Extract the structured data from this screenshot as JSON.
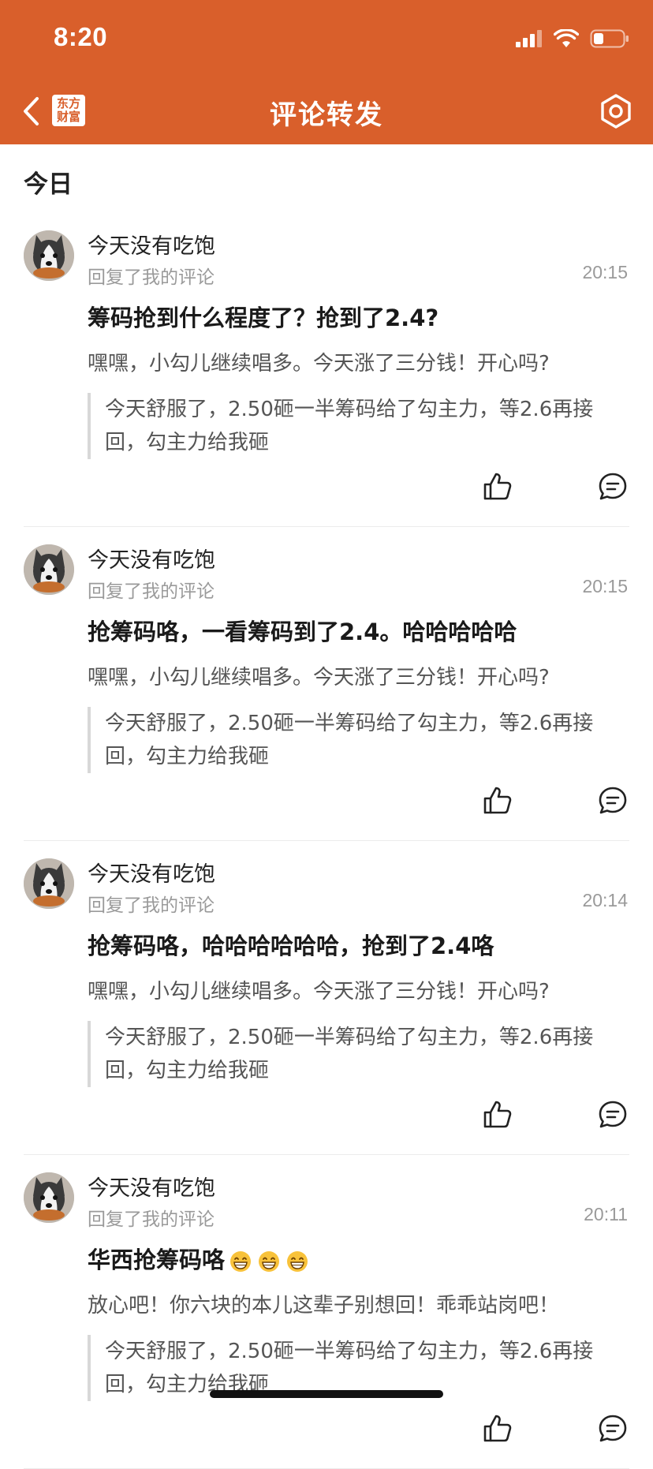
{
  "status_bar": {
    "time": "8:20"
  },
  "nav": {
    "logo_line1": "东方",
    "logo_line2": "财富",
    "title": "评论转发"
  },
  "section": {
    "title": "今日"
  },
  "colors": {
    "brand": "#d95f2b"
  },
  "items": [
    {
      "username": "今天没有吃饱",
      "subline": "回复了我的评论",
      "time": "20:15",
      "content": "筹码抢到什么程度了？抢到了2.4?",
      "emoji_count": 0,
      "reply": "嘿嘿，小勾儿继续唱多。今天涨了三分钱！开心吗?",
      "quote": "今天舒服了，2.50砸一半筹码给了勾主力，等2.6再接回，勾主力给我砸"
    },
    {
      "username": "今天没有吃饱",
      "subline": "回复了我的评论",
      "time": "20:15",
      "content": "抢筹码咯，一看筹码到了2.4。哈哈哈哈哈",
      "emoji_count": 0,
      "reply": "嘿嘿，小勾儿继续唱多。今天涨了三分钱！开心吗?",
      "quote": "今天舒服了，2.50砸一半筹码给了勾主力，等2.6再接回，勾主力给我砸"
    },
    {
      "username": "今天没有吃饱",
      "subline": "回复了我的评论",
      "time": "20:14",
      "content": "抢筹码咯，哈哈哈哈哈哈，抢到了2.4咯",
      "emoji_count": 0,
      "reply": "嘿嘿，小勾儿继续唱多。今天涨了三分钱！开心吗?",
      "quote": "今天舒服了，2.50砸一半筹码给了勾主力，等2.6再接回，勾主力给我砸"
    },
    {
      "username": "今天没有吃饱",
      "subline": "回复了我的评论",
      "time": "20:11",
      "content": "华西抢筹码咯",
      "emoji_count": 3,
      "reply": "放心吧！你六块的本儿这辈子别想回！乖乖站岗吧！",
      "quote": "今天舒服了，2.50砸一半筹码给了勾主力，等2.6再接回，勾主力给我砸"
    }
  ]
}
